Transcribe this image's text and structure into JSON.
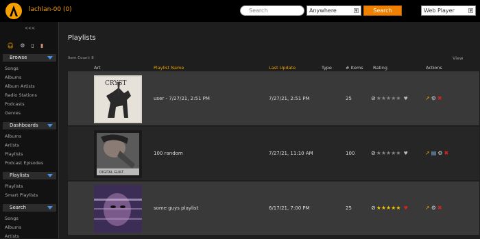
{
  "header": {
    "user": "lachlan-00 (0)",
    "search_placeholder": "Search",
    "search_scope": "Anywhere",
    "search_button": "Search",
    "player_mode": "Web Player"
  },
  "sidebar": {
    "collapse": "<<<",
    "sections": [
      {
        "title": "Browse",
        "items": [
          "Songs",
          "Albums",
          "Album Artists",
          "Radio Stations",
          "Podcasts",
          "Genres"
        ]
      },
      {
        "title": "Dashboards",
        "items": [
          "Albums",
          "Artists",
          "Playlists",
          "Podcast Episodes"
        ]
      },
      {
        "title": "Playlists",
        "items": [
          "Playlists",
          "Smart Playlists"
        ]
      },
      {
        "title": "Search",
        "items": [
          "Songs",
          "Albums",
          "Artists"
        ]
      }
    ]
  },
  "main": {
    "title": "Playlists",
    "item_count": "Item Count: 8",
    "view_label": "View",
    "columns": [
      "Art",
      "Playlist Name",
      "Last Update",
      "Type",
      "# Items",
      "Rating",
      "Actions"
    ],
    "rows": [
      {
        "name": "user - 7/27/21, 2:51 PM",
        "last_update": "7/27/21, 2:51 PM",
        "type": "",
        "items": "25",
        "rating": 0,
        "favorite": false,
        "actions": [
          "share-icon",
          "gear-icon",
          "delete-icon"
        ]
      },
      {
        "name": "100 random",
        "last_update": "7/27/21, 11:10 AM",
        "type": "",
        "items": "100",
        "rating": 0,
        "favorite": false,
        "actions": [
          "share-icon",
          "document-icon",
          "gear-icon",
          "delete-icon"
        ]
      },
      {
        "name": "some guys playlist",
        "last_update": "6/17/21, 7:00 PM",
        "type": "",
        "items": "25",
        "rating": 5,
        "favorite": true,
        "actions": [
          "share-icon",
          "gear-icon",
          "delete-icon"
        ]
      }
    ]
  },
  "colors": {
    "accent": "#f08000",
    "brand_text": "#f5a000",
    "star": "#f3c400",
    "heart": "#e02020",
    "row_dark": "#393939",
    "row_light": "#262626"
  }
}
